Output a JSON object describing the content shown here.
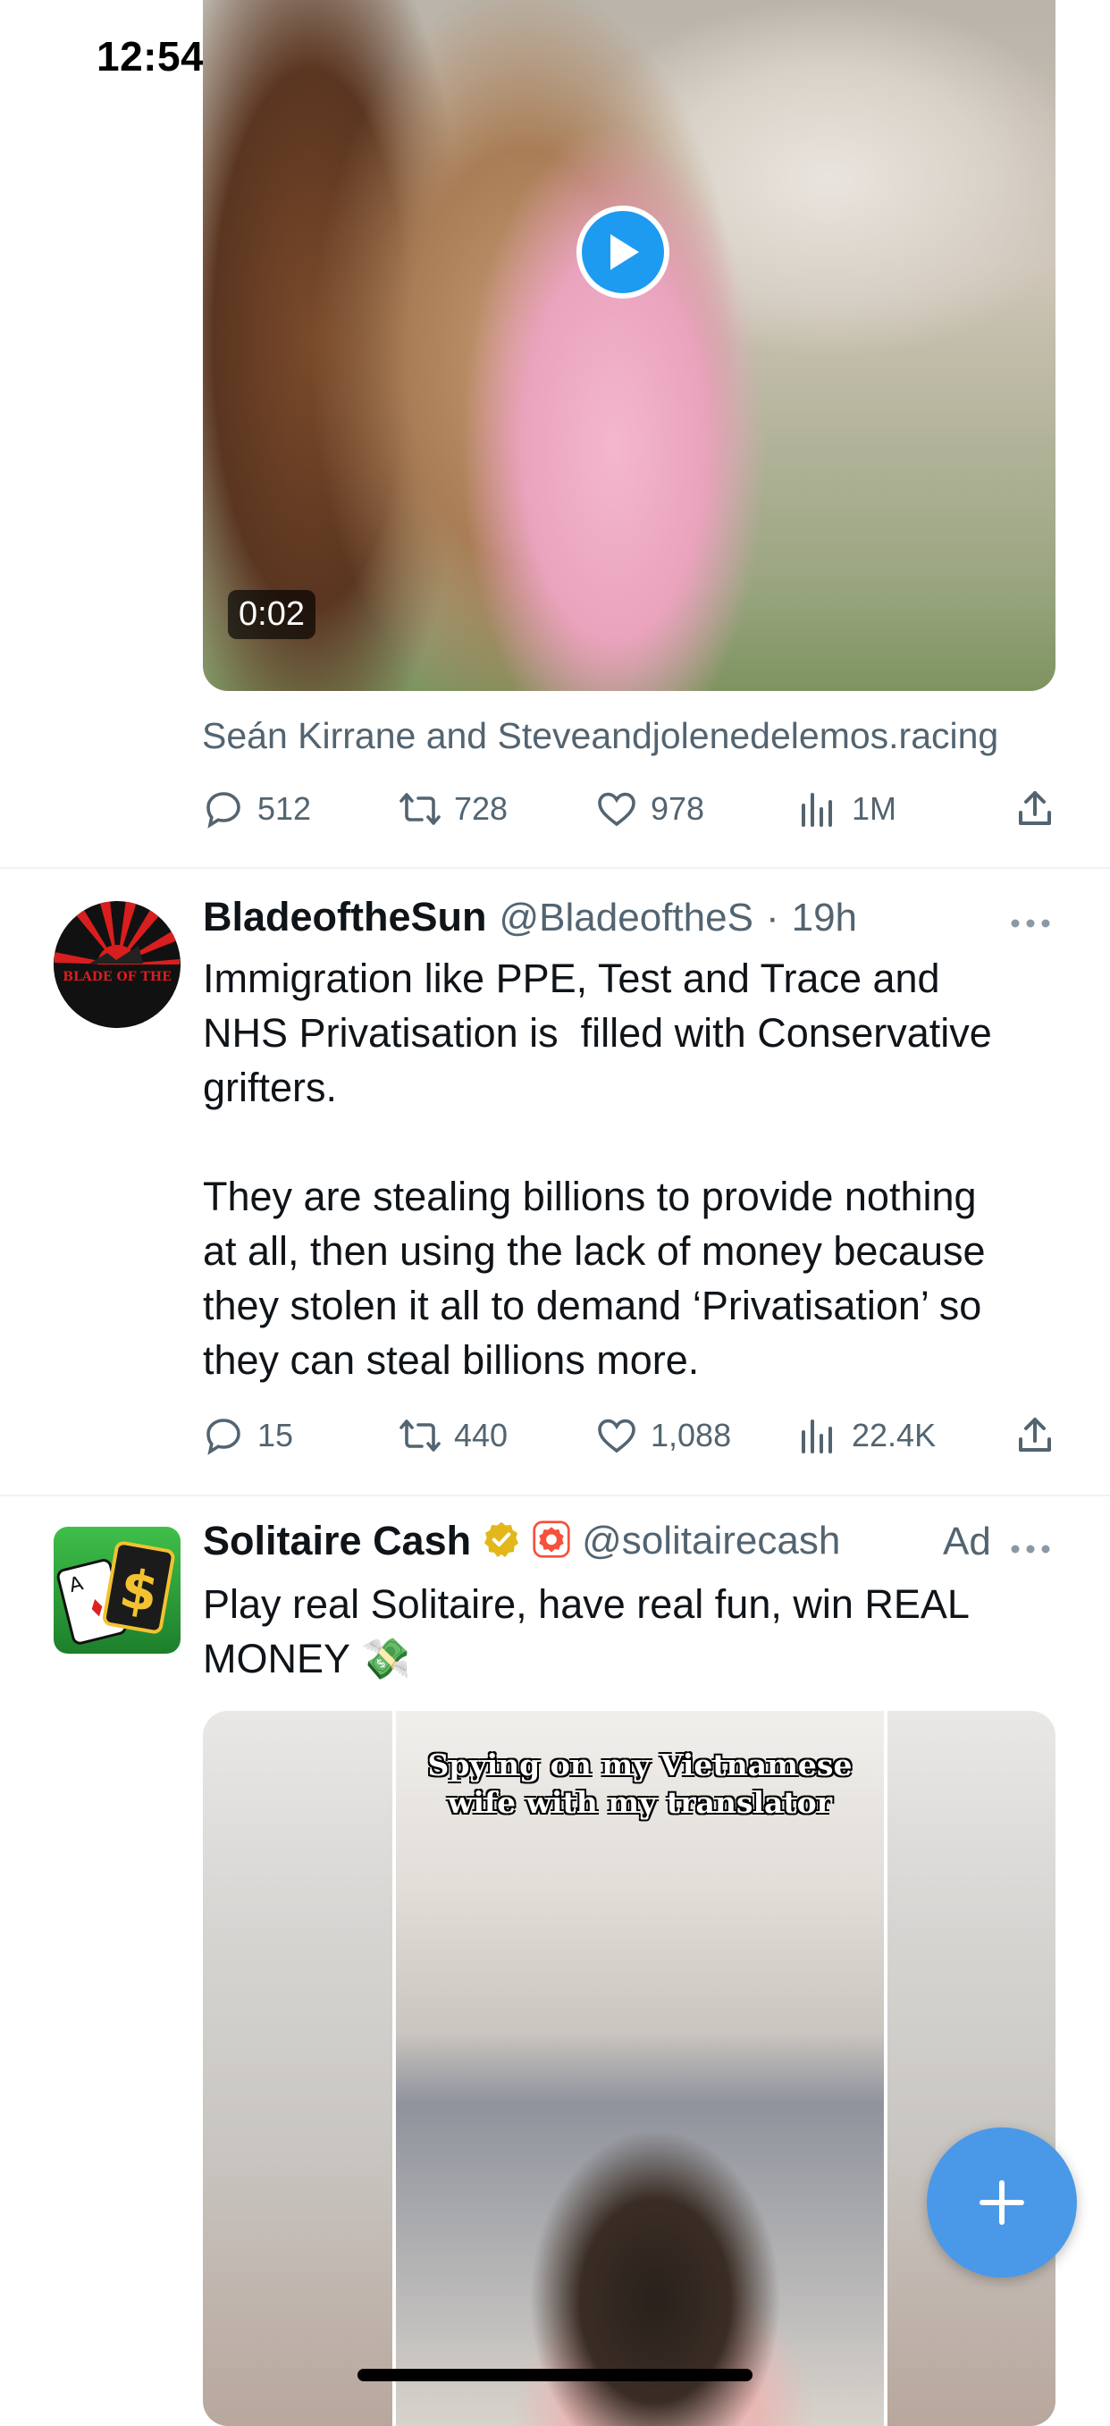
{
  "status_bar": {
    "time": "12:54"
  },
  "tweet1": {
    "media_duration": "0:02",
    "tagged_users": "Seán Kirrane and Steveandjolenedelemos.racing",
    "actions": {
      "replies": "512",
      "retweets": "728",
      "likes": "978",
      "views": "1M"
    }
  },
  "tweet2": {
    "name": "BladeoftheSun",
    "handle": "@BladeoftheS",
    "separator": "·",
    "time": "19h",
    "avatar_text": "BLADE OF THE",
    "text": "Immigration like PPE, Test and Trace and\nNHS Privatisation is  filled with Conservative\ngrifters.\n\nThey are stealing billions to provide nothing\nat all, then using the lack of money because\nthey stolen it all to demand ‘Privatisation’ so\nthey can steal billions more.",
    "actions": {
      "replies": "15",
      "retweets": "440",
      "likes": "1,088",
      "views": "22.4K"
    }
  },
  "tweet3": {
    "name": "Solitaire Cash",
    "handle": "@solitairecash",
    "ad_label": "Ad",
    "text": "Play real Solitaire, have real fun, win REAL\nMONEY 💸",
    "media_caption": "Spying on my Vietnamese\nwife with my translator"
  },
  "colors": {
    "accent": "#1d9bf0",
    "fab": "#4a99e9",
    "muted": "#536471",
    "verified": "#e2b719",
    "affiliate": "#f4523b"
  },
  "icons": [
    "play-icon",
    "reply-icon",
    "retweet-icon",
    "like-icon",
    "views-icon",
    "share-icon",
    "more-icon",
    "verified-badge-icon",
    "affiliate-badge-icon",
    "compose-plus-icon",
    "wifi-icon",
    "battery-charging-icon",
    "signal-icon"
  ]
}
